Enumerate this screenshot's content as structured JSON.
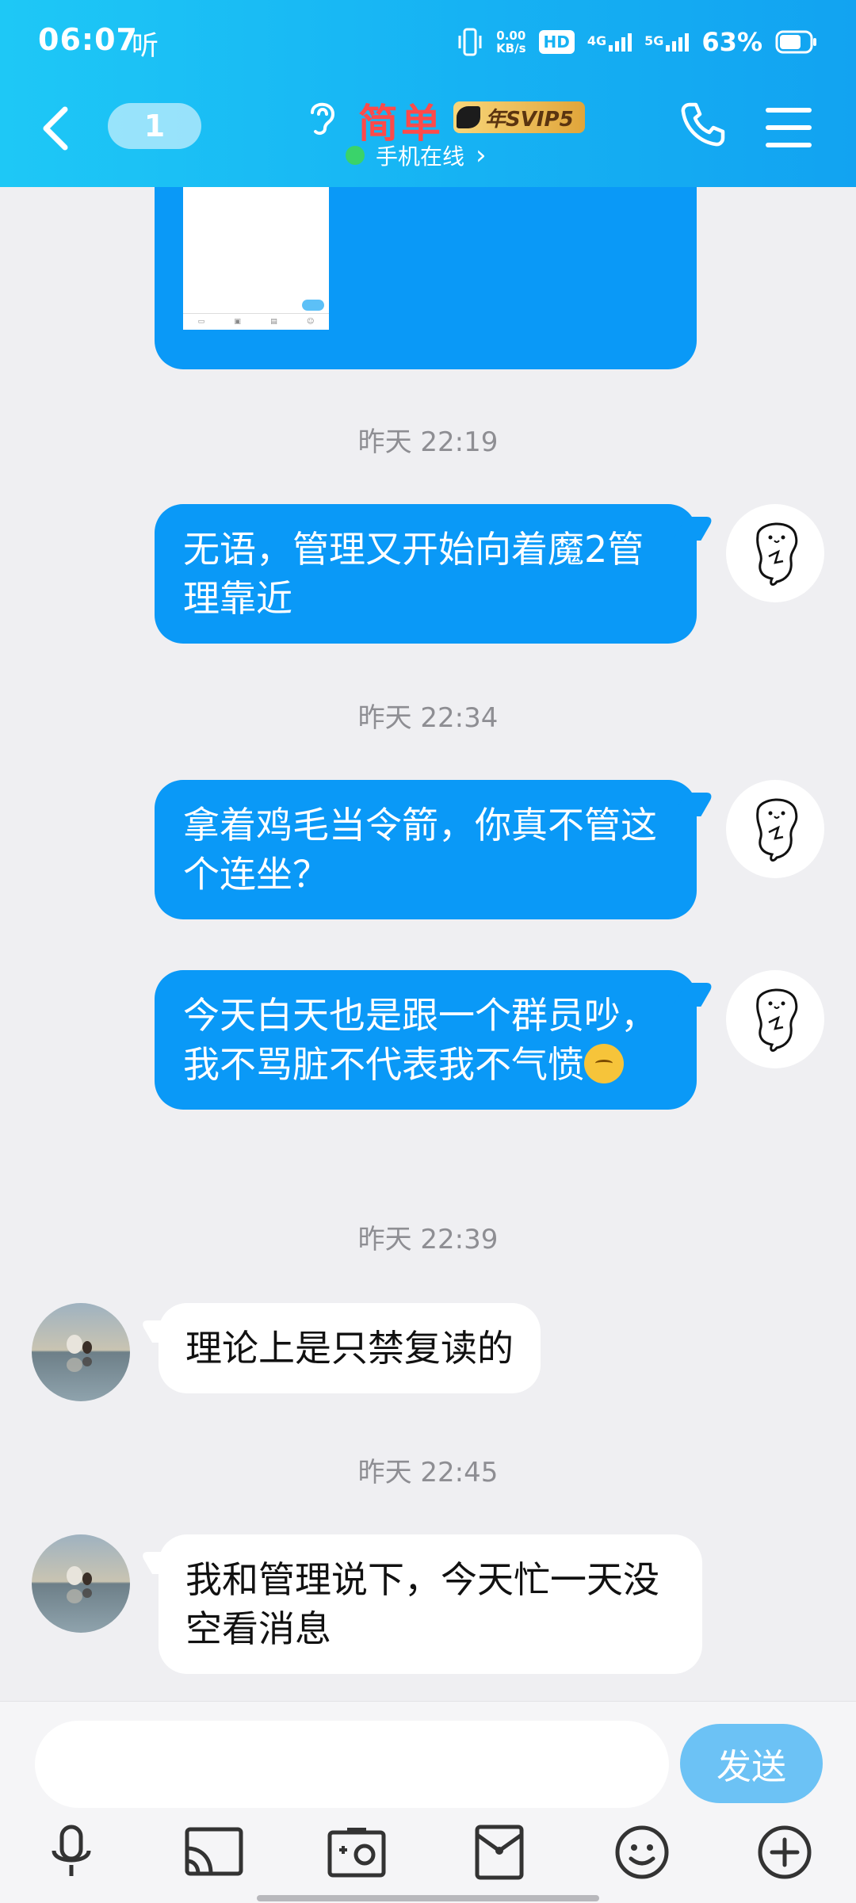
{
  "status_bar": {
    "time": "06:07",
    "extra": "听",
    "speed_top": "0.00",
    "speed_unit": "KB/s",
    "hd_label": "HD",
    "net_4g": "4G",
    "net_5g": "5G",
    "battery": "63%"
  },
  "header": {
    "unread_count": "1",
    "contact_name": "简单",
    "vip_label": "年SVIP5",
    "online_status": "手机在线",
    "online_chevron": "›"
  },
  "messages": [
    {
      "type": "image",
      "from": "me"
    },
    {
      "type": "timestamp",
      "text": "昨天 22:19"
    },
    {
      "type": "text",
      "from": "me",
      "text": "无语，管理又开始向着魔2管理靠近"
    },
    {
      "type": "timestamp",
      "text": "昨天 22:34"
    },
    {
      "type": "text",
      "from": "me",
      "text": "拿着鸡毛当令箭，你真不管这个连坐？"
    },
    {
      "type": "text",
      "from": "me",
      "text": "今天白天也是跟一个群员吵，我不骂脏不代表我不气愤",
      "emoji": "smirk-emoji"
    },
    {
      "type": "timestamp",
      "text": "昨天 22:39"
    },
    {
      "type": "text",
      "from": "other",
      "text": "理论上是只禁复读的"
    },
    {
      "type": "timestamp",
      "text": "昨天 22:45"
    },
    {
      "type": "text",
      "from": "other",
      "text": "我和管理说下，今天忙一天没空看消息"
    }
  ],
  "input": {
    "placeholder": "",
    "send_label": "发送"
  },
  "toolbar": [
    "microphone-icon",
    "screen-cast-icon",
    "photo-icon",
    "red-packet-icon",
    "emoji-icon",
    "plus-icon"
  ],
  "colors": {
    "header_start": "#1ec8f6",
    "header_end": "#12a3f1",
    "my_bubble": "#0a99f7",
    "their_bubble": "#ffffff",
    "send_button": "#6cc2f5",
    "contact_name": "#ff4a4a",
    "online_dot": "#3ad36a"
  }
}
